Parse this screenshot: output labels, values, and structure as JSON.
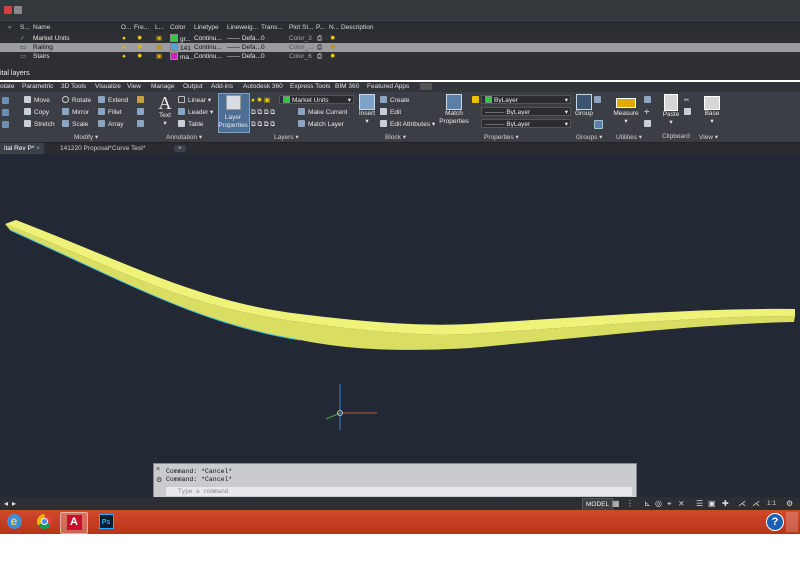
{
  "layer_panel": {
    "columns": [
      "S...",
      "Name",
      "O...",
      "Fre...",
      "L...",
      "Color",
      "Linetype",
      "Lineweig...",
      "Trans...",
      "Plot St...",
      "P...",
      "N...",
      "Description"
    ],
    "rows": [
      {
        "name": "Market Units",
        "color_label": "gr...",
        "color": "#2ecc40",
        "linetype": "Continu...",
        "lineweight": "Defa...",
        "transparency": "0",
        "plot_style": "Color_3",
        "selected": false
      },
      {
        "name": "Railing",
        "color_label": "141",
        "color": "#4fa3d9",
        "linetype": "Continu...",
        "lineweight": "Defa...",
        "transparency": "0",
        "plot_style": "Color_...",
        "selected": true
      },
      {
        "name": "Stairs",
        "color_label": "ma...",
        "color": "#d020c8",
        "linetype": "Continu...",
        "lineweight": "Defa...",
        "transparency": "0",
        "plot_style": "Color_6",
        "selected": false
      }
    ],
    "footer_text": "ital layers"
  },
  "ribbon_tabs": [
    "Parametric",
    "3D Tools",
    "Visualize",
    "View",
    "Manage",
    "Output",
    "Add-ins",
    "Autodesk 360",
    "Express Tools",
    "BIM 360",
    "Featured Apps"
  ],
  "ribbon_first_tab_partial": "otate",
  "ribbon": {
    "modify": {
      "items": [
        "Move",
        "Rotate",
        "Extend",
        "Copy",
        "Mirror",
        "Fillet",
        "Stretch",
        "Scale",
        "Array"
      ],
      "label": "Modify"
    },
    "annotation": {
      "text_label": "Text",
      "items": [
        "Linear",
        "Leader",
        "Table"
      ],
      "label": "Annotation"
    },
    "layers": {
      "layer_properties_line1": "Layer",
      "layer_properties_line2": "Properties",
      "current_layer": "Market Units",
      "make_current": "Make Current",
      "match_layer": "Match Layer",
      "label": "Layers"
    },
    "block": {
      "insert": "Insert",
      "create": "Create",
      "edit": "Edit",
      "edit_attributes": "Edit Attributes",
      "label": "Block"
    },
    "properties": {
      "match_line1": "Match",
      "match_line2": "Properties",
      "color": "ByLayer",
      "linetype": "ByLayer",
      "lineweight": "ByLayer",
      "label": "Properties"
    },
    "groups": {
      "group": "Group",
      "label": "Groups"
    },
    "utilities": {
      "measure": "Measure",
      "label": "Utilities"
    },
    "clipboard": {
      "paste": "Paste",
      "label": "Clipboard"
    },
    "view": {
      "base": "Base",
      "label": "View"
    }
  },
  "file_tabs": [
    "ital Rev P*",
    "141220 Proposal*",
    "Curve Test*"
  ],
  "command": {
    "history": [
      "Command: *Cancel*",
      "Command: *Cancel*"
    ],
    "placeholder": "Type a command"
  },
  "status": {
    "model": "MODEL",
    "scale": "1:1"
  },
  "colors": {
    "viewport_bg": "#222834",
    "railing": "#e9ef7a",
    "taskbar": "#c53c1f"
  },
  "taskbar_apps": [
    "internet-explorer",
    "chrome",
    "autocad",
    "photoshop"
  ]
}
